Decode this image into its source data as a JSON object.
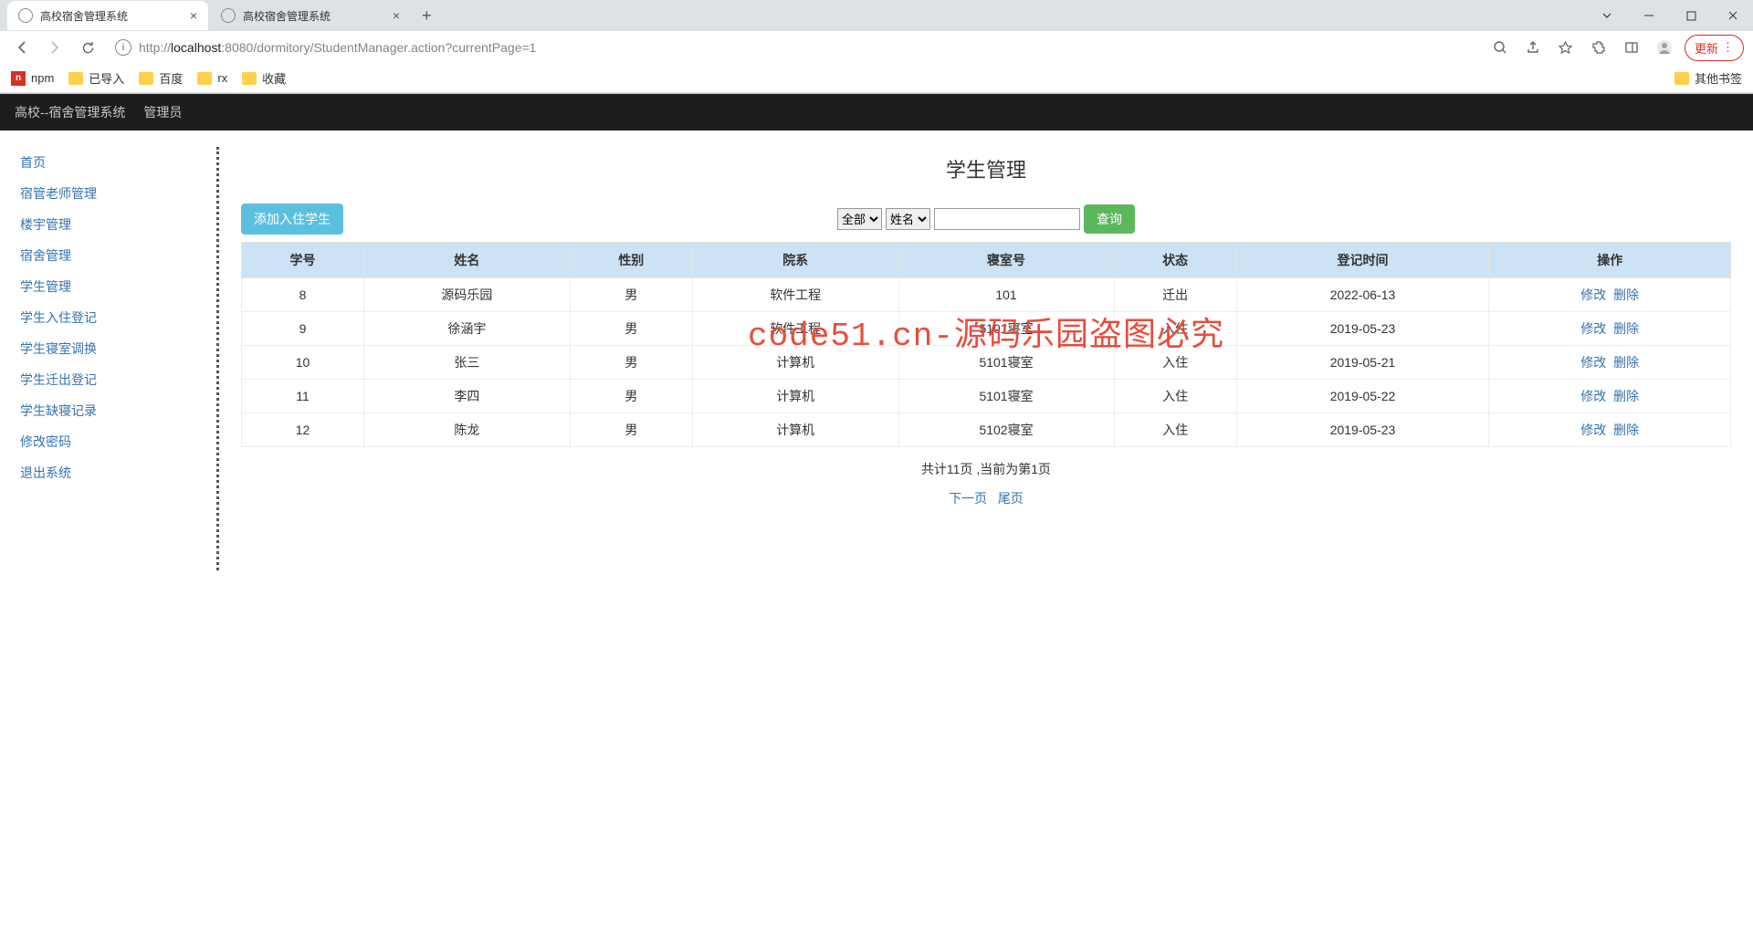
{
  "browser": {
    "tabs": [
      {
        "title": "高校宿舍管理系统",
        "active": true
      },
      {
        "title": "高校宿舍管理系统",
        "active": false
      }
    ],
    "url_prefix": "http://",
    "url_host": "localhost",
    "url_rest": ":8080/dormitory/StudentManager.action?currentPage=1",
    "update_label": "更新",
    "bookmarks": [
      "npm",
      "已导入",
      "百度",
      "rx",
      "收藏"
    ],
    "other_bookmarks": "其他书签"
  },
  "topnav": {
    "brand": "高校--宿舍管理系统",
    "role": "管理员"
  },
  "sidebar": {
    "items": [
      "首页",
      "宿管老师管理",
      "楼宇管理",
      "宿舍管理",
      "学生管理",
      "学生入住登记",
      "学生寝室调换",
      "学生迁出登记",
      "学生缺寝记录",
      "修改密码",
      "退出系统"
    ]
  },
  "main": {
    "title": "学生管理",
    "add_btn": "添加入住学生",
    "filter_scope_options": [
      "全部"
    ],
    "filter_scope_value": "全部",
    "filter_by_options": [
      "姓名"
    ],
    "filter_by_value": "姓名",
    "search_btn": "查询",
    "columns": [
      "学号",
      "姓名",
      "性别",
      "院系",
      "寝室号",
      "状态",
      "登记时间",
      "操作"
    ],
    "rows": [
      {
        "id": "8",
        "name": "源码乐园",
        "gender": "男",
        "dept": "软件工程",
        "room": "101",
        "status": "迁出",
        "date": "2022-06-13"
      },
      {
        "id": "9",
        "name": "徐涵宇",
        "gender": "男",
        "dept": "软件工程",
        "room": "5101寝室",
        "status": "入住",
        "date": "2019-05-23"
      },
      {
        "id": "10",
        "name": "张三",
        "gender": "男",
        "dept": "计算机",
        "room": "5101寝室",
        "status": "入住",
        "date": "2019-05-21"
      },
      {
        "id": "11",
        "name": "李四",
        "gender": "男",
        "dept": "计算机",
        "room": "5101寝室",
        "status": "入住",
        "date": "2019-05-22"
      },
      {
        "id": "12",
        "name": "陈龙",
        "gender": "男",
        "dept": "计算机",
        "room": "5102寝室",
        "status": "入住",
        "date": "2019-05-23"
      }
    ],
    "op_edit": "修改",
    "op_delete": "删除",
    "page_info": "共计11页 ,当前为第1页",
    "next_page": "下一页",
    "last_page": "尾页"
  },
  "watermark": "code51.cn-源码乐园盗图必究"
}
